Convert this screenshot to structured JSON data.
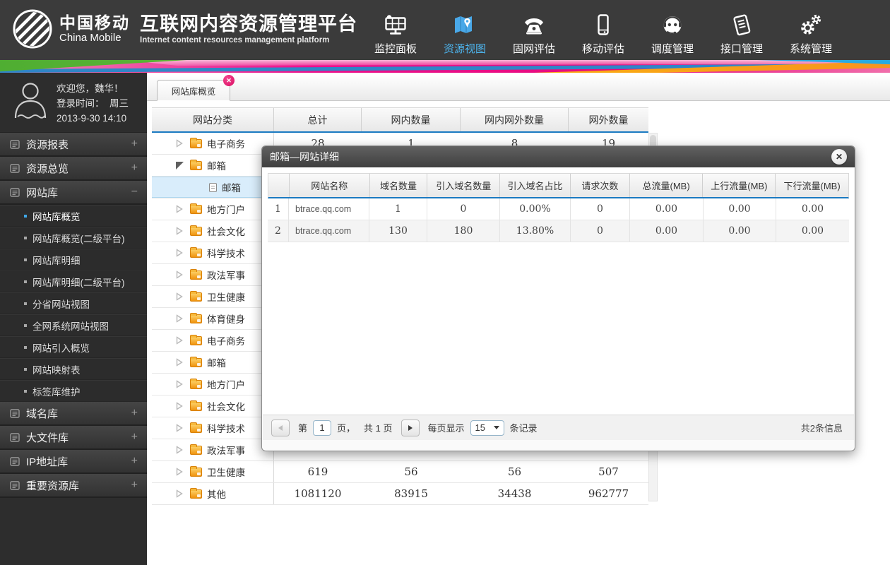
{
  "header": {
    "logo": {
      "cn": "中国移动",
      "en": "China Mobile",
      "icon": "china-mobile-logo-icon"
    },
    "title": "互联网内容资源管理平台",
    "subtitle": "Internet content resources management platform",
    "nav": [
      {
        "label": "监控面板",
        "icon": "dashboard-icon",
        "active": false
      },
      {
        "label": "资源视图",
        "icon": "map-pin-icon",
        "active": true
      },
      {
        "label": "固网评估",
        "icon": "telephone-icon",
        "active": false
      },
      {
        "label": "移动评估",
        "icon": "mobile-phone-icon",
        "active": false
      },
      {
        "label": "调度管理",
        "icon": "operator-headset-icon",
        "active": false
      },
      {
        "label": "接口管理",
        "icon": "document-notes-icon",
        "active": false
      },
      {
        "label": "系统管理",
        "icon": "gears-icon",
        "active": false
      }
    ],
    "colors": {
      "header_bg": "#3b3b3b",
      "active_nav": "#4db5ef",
      "accent_blue": "#1b7ac2",
      "tab_close_pink": "#d80d63"
    }
  },
  "sidebar": {
    "welcome": "欢迎您，魏华！",
    "login_label": "登录时间：",
    "login_day": "周三",
    "login_datetime": "2013-9-30   14:10",
    "menus": [
      {
        "label": "资源报表",
        "toggle": "+"
      },
      {
        "label": "资源总览",
        "toggle": "+"
      },
      {
        "label": "网站库",
        "toggle": "−",
        "expanded": true,
        "children": [
          {
            "label": "网站库概览",
            "active": true
          },
          {
            "label": "网站库概览(二级平台)",
            "active": false
          },
          {
            "label": "网站库明细",
            "active": false
          },
          {
            "label": "网站库明细(二级平台)",
            "active": false
          },
          {
            "label": "分省网站视图",
            "active": false
          },
          {
            "label": "全网系统网站视图",
            "active": false
          },
          {
            "label": "网站引入概览",
            "active": false
          },
          {
            "label": "网站映射表",
            "active": false
          },
          {
            "label": "标签库维护",
            "active": false
          }
        ]
      },
      {
        "label": "域名库",
        "toggle": "+"
      },
      {
        "label": "大文件库",
        "toggle": "+"
      },
      {
        "label": "IP地址库",
        "toggle": "+"
      },
      {
        "label": "重要资源库",
        "toggle": "+"
      }
    ]
  },
  "main": {
    "tab": {
      "label": "网站库概览",
      "closable": true
    },
    "table": {
      "columns": [
        "网站分类",
        "总计",
        "网内数量",
        "网内网外数量",
        "网外数量"
      ],
      "rows": [
        {
          "label": "电子商务",
          "level": 1,
          "state": "collapsed",
          "values": [
            "28",
            "1",
            "8",
            "19"
          ]
        },
        {
          "label": "邮箱",
          "level": 1,
          "state": "expanded"
        },
        {
          "label": "邮箱",
          "level": 2,
          "state": "leaf",
          "selected": true
        },
        {
          "label": "地方门户",
          "level": 1,
          "state": "collapsed"
        },
        {
          "label": "社会文化",
          "level": 1,
          "state": "collapsed"
        },
        {
          "label": "科学技术",
          "level": 1,
          "state": "collapsed"
        },
        {
          "label": "政法军事",
          "level": 1,
          "state": "collapsed"
        },
        {
          "label": "卫生健康",
          "level": 1,
          "state": "collapsed"
        },
        {
          "label": "体育健身",
          "level": 1,
          "state": "collapsed"
        },
        {
          "label": "电子商务",
          "level": 1,
          "state": "collapsed"
        },
        {
          "label": "邮箱",
          "level": 1,
          "state": "collapsed"
        },
        {
          "label": "地方门户",
          "level": 1,
          "state": "collapsed"
        },
        {
          "label": "社会文化",
          "level": 1,
          "state": "collapsed"
        },
        {
          "label": "科学技术",
          "level": 1,
          "state": "collapsed"
        },
        {
          "label": "政法军事",
          "level": 1,
          "state": "collapsed"
        },
        {
          "label": "卫生健康",
          "level": 1,
          "state": "collapsed",
          "values": [
            "619",
            "56",
            "56",
            "507"
          ]
        },
        {
          "label": "其他",
          "level": 1,
          "state": "collapsed",
          "values": [
            "1081120",
            "83915",
            "34438",
            "962777"
          ]
        }
      ]
    }
  },
  "modal": {
    "title": "邮箱—网站详细",
    "columns": [
      "",
      "网站名称",
      "域名数量",
      "引入域名数量",
      "引入域名占比",
      "请求次数",
      "总流量(MB)",
      "上行流量(MB)",
      "下行流量(MB)"
    ],
    "rows": [
      [
        "1",
        "btrace.qq.com",
        "1",
        "0",
        "0.00%",
        "0",
        "0.00",
        "0.00",
        "0.00"
      ],
      [
        "2",
        "btrace.qq.com",
        "130",
        "180",
        "13.80%",
        "0",
        "0.00",
        "0.00",
        "0.00"
      ]
    ],
    "pagination": {
      "page_prefix": "第",
      "page_value": "1",
      "page_suffix": "页，",
      "total_pages": "共 1 页",
      "per_page_label": "每页显示",
      "per_page_value": "15",
      "per_page_suffix": "条记录",
      "total_info": "共2条信息"
    }
  }
}
